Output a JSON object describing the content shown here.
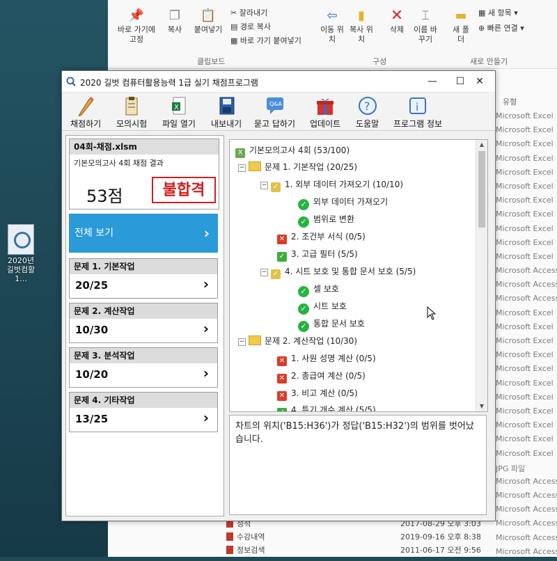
{
  "desktop": {
    "icon_label": "2020년 길벗컴활1..."
  },
  "ribbon": {
    "pin_label": "바로 가기에 고정",
    "copy_label": "복사",
    "paste_label": "붙여넣기",
    "cut_label": "잘라내기",
    "copy_path_label": "경로 복사",
    "paste_shortcut_label": "바로 가기 붙여넣기",
    "move_label": "이동 위치",
    "copy_to_label": "복사 위치",
    "delete_label": "삭제",
    "rename_label": "이름 바꾸기",
    "new_folder_label": "새 폴더",
    "new_item_label": "새 항목",
    "easy_access_label": "빠른 연결",
    "group_clipboard": "클립보드",
    "group_organize": "구성",
    "group_new": "새로 만들기"
  },
  "explorer": {
    "type_header": "유형",
    "types": [
      "Microsoft Excel",
      "Microsoft Excel",
      "Microsoft Excel",
      "Microsoft Excel",
      "Microsoft Excel",
      "Microsoft Excel",
      "Microsoft Excel",
      "Microsoft Excel",
      "Microsoft Excel",
      "Microsoft Excel",
      "Microsoft Excel",
      "Microsoft Access",
      "Microsoft Access",
      "Microsoft Access",
      "Microsoft Excel",
      "Microsoft Excel",
      "Microsoft Excel",
      "Microsoft Excel",
      "Microsoft Excel",
      "Microsoft Excel",
      "Microsoft Excel",
      "Microsoft Excel",
      "Microsoft Excel",
      "Microsoft Excel",
      "Microsoft Excel",
      "JPG 파일",
      "Microsoft Access",
      "Microsoft Access",
      "Microsoft Access",
      "Microsoft Access",
      "Microsoft Access",
      "Microsoft Access"
    ],
    "bottom_files": [
      {
        "name": "성적",
        "date": "2017-08-29 오후 3:03"
      },
      {
        "name": "수강내역",
        "date": "2019-09-16 오후 8:38"
      },
      {
        "name": "정보검색",
        "date": "2011-06-17 오전 9:56"
      }
    ]
  },
  "window": {
    "title": "2020 길벗 컴퓨터활용능력 1급 실기 채점프로그램",
    "min": "—",
    "max": "☐",
    "close": "✕"
  },
  "toolbar": {
    "grade": "채점하기",
    "mock": "모의시험",
    "open": "파일 열기",
    "export": "내보내기",
    "qa": "묻고 답하기",
    "update": "업데이트",
    "help": "도움말",
    "info": "프로그램 정보"
  },
  "left": {
    "file_name": "04회-채점.xlsm",
    "file_sub": "기본모의고사 4회 채점 결과",
    "score": "53점",
    "stamp": "불합격",
    "view_all": "전체 보기",
    "problems": [
      {
        "title": "문제 1. 기본작업",
        "value": "20/25"
      },
      {
        "title": "문제 2. 계산작업",
        "value": "10/30"
      },
      {
        "title": "문제 3. 분석작업",
        "value": "10/20"
      },
      {
        "title": "문제 4. 기타작업",
        "value": "13/25"
      }
    ]
  },
  "tree": {
    "root": "기본모의고사 4회 (53/100)",
    "p1": "문제 1. 기본작업 (20/25)",
    "p1_1": "1. 외부 데이터 가져오기 (10/10)",
    "p1_1a": "외부 데이터 가져오기",
    "p1_1b": "범위로 변환",
    "p1_2": "2. 조건부 서식 (0/5)",
    "p1_3": "3. 고급 필터 (5/5)",
    "p1_4": "4. 시트 보호 및 통합 문서 보호 (5/5)",
    "p1_4a": "셀 보호",
    "p1_4b": "시트 보호",
    "p1_4c": "통합 문서 보호",
    "p2": "문제 2. 계산작업 (10/30)",
    "p2_1": "1. 사원 성명 계산 (0/5)",
    "p2_2": "2. 총급여 계산 (0/5)",
    "p2_3": "3. 비고 계산 (0/5)",
    "p2_4": "4. 특기 개수 계산 (5/5)"
  },
  "message": "차트의 위치('B15:H36')가 정답('B15:H32')의 범위를 벗어났습니다."
}
